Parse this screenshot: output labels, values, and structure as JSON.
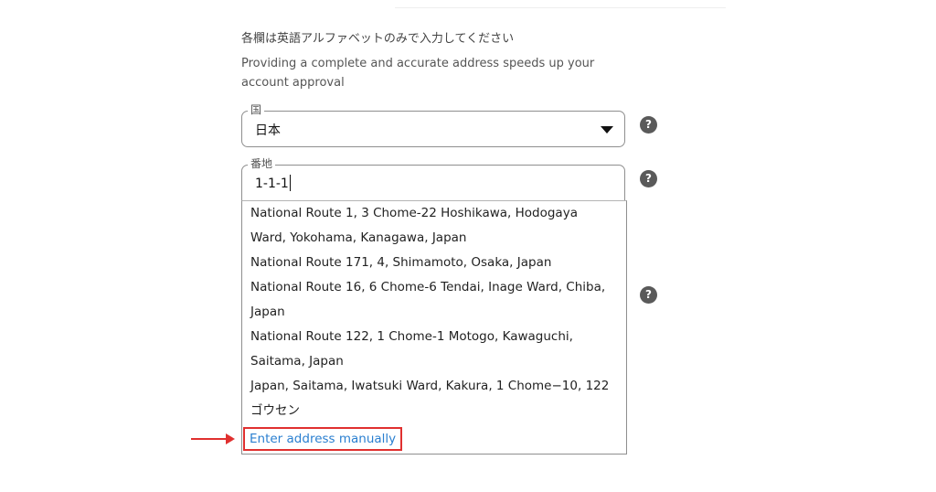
{
  "form": {
    "instruction": "各欄は英語アルファベットのみで入力してください",
    "note": "Providing a complete and accurate address speeds up your account approval",
    "country_label": "国",
    "country_value": "日本",
    "address_label": "番地",
    "address_value": "1-1-1",
    "help_icon": "?",
    "suggestions": [
      "National Route 1, 3 Chome-22 Hoshikawa, Hodogaya Ward, Yokohama, Kanagawa, Japan",
      "National Route 171, 4, Shimamoto, Osaka, Japan",
      "National Route 16, 6 Chome-6 Tendai, Inage Ward, Chiba, Japan",
      "National Route 122, 1 Chome-1 Motogo, Kawaguchi, Saitama, Japan",
      "Japan, Saitama, Iwatsuki Ward, Kakura, 1 Chome−10, 122 ゴウセン"
    ],
    "manual_link": "Enter address manually"
  },
  "colors": {
    "highlight": "#e0302f",
    "link": "#2a7fd0"
  },
  "icons": {
    "help": "question-circle-icon",
    "dropdown": "caret-down-icon",
    "annotation": "arrow-right-icon"
  }
}
